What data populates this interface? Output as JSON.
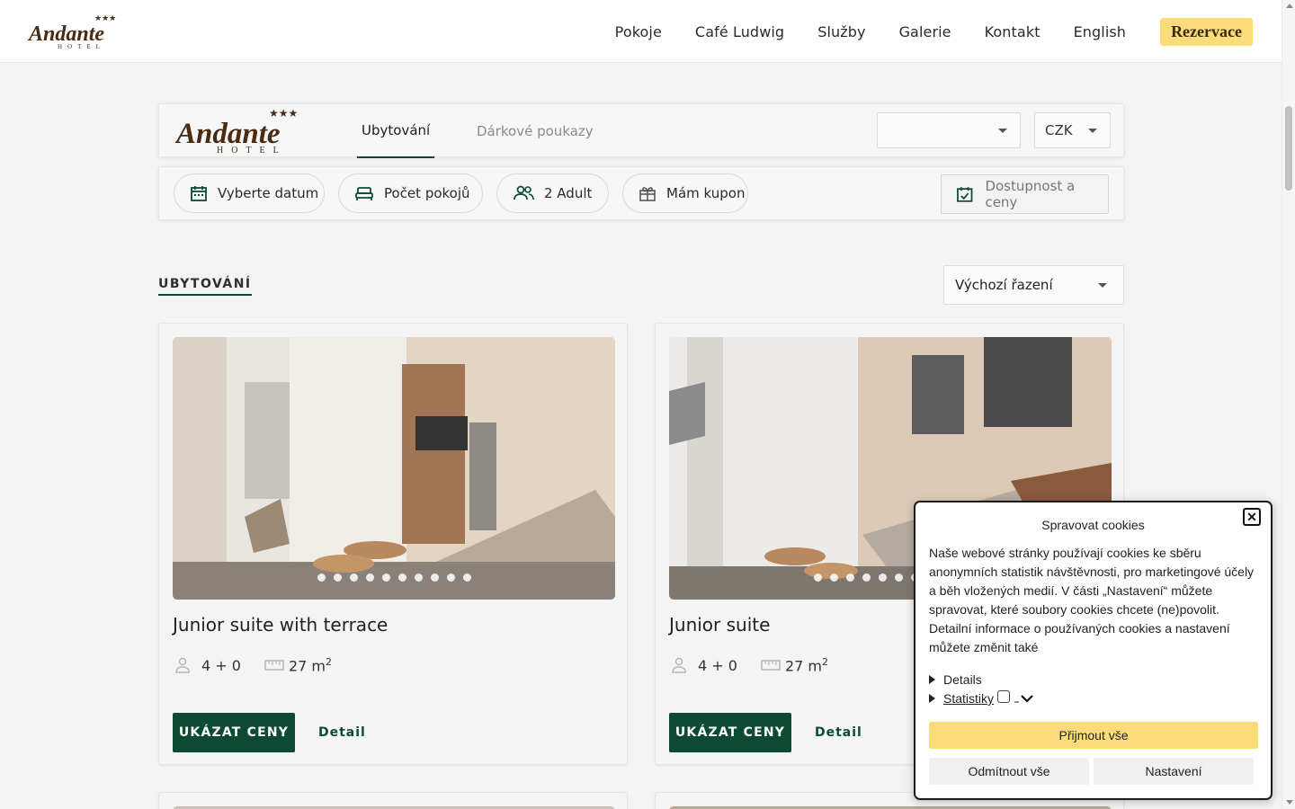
{
  "brand": {
    "script": "Andante",
    "sub": "HOTEL",
    "stars": "★★★"
  },
  "nav": {
    "items": [
      "Pokoje",
      "Café Ludwig",
      "Služby",
      "Galerie",
      "Kontakt",
      "English"
    ],
    "cta": "Rezervace"
  },
  "booking": {
    "tabs": {
      "active": "Ubytování",
      "inactive": "Dárkové poukazy"
    },
    "language_select": "",
    "currency_select": "CZK",
    "date_pill": "Vyberte datum",
    "rooms_pill": "Počet pokojů",
    "guests_pill": "2 Adult",
    "coupon_pill": "Mám kupon",
    "availability_button": "Dostupnost a ceny"
  },
  "listing": {
    "title": "UBYTOVÁNÍ",
    "sort": "Výchozí řazení"
  },
  "rooms": [
    {
      "name": "Junior suite with terrace",
      "occupancy": "4 + 0",
      "size": "27 m",
      "unit_sup": "2",
      "cta": "UKÁZAT CENY",
      "detail": "Detail",
      "photo_count": 10
    },
    {
      "name": "Junior suite",
      "occupancy": "4 + 0",
      "size": "27 m",
      "unit_sup": "2",
      "cta": "UKÁZAT CENY",
      "detail": "Detail",
      "photo_count": 10
    }
  ],
  "cookies": {
    "title": "Spravovat cookies",
    "text": "Naše webové stránky používají cookies ke sběru anonymních statistik návštěvnosti, pro marketingové účely a běh vložených medií. V části „Nastavení“ můžete spravovat, které soubory cookies chcete (ne)povolit. Detailní informace o používaných cookies a nastavení můžete změnit také",
    "details": "Details",
    "statistics": "Statistiky",
    "accept": "Přijmout vše",
    "deny": "Odmítnout vše",
    "settings": "Nastavení"
  },
  "colors": {
    "brand_green": "#0c4a34",
    "accent_yellow": "#fbdc79",
    "logo_brown": "#4a2a10"
  }
}
